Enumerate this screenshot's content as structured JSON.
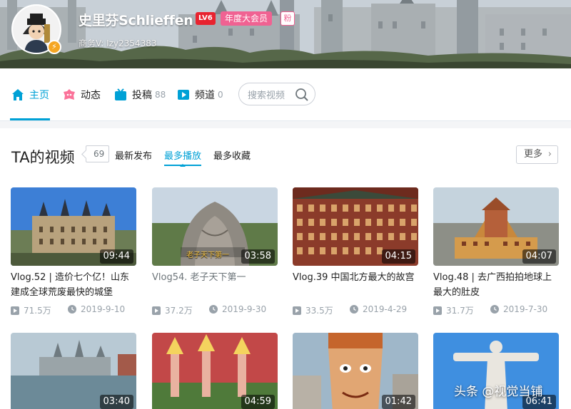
{
  "profile": {
    "username": "史里芬Schlieffen",
    "level": "LV6",
    "vip_badge": "年度大会员",
    "fan_badge": "粉",
    "business": "商务V: Izy2354383",
    "colors": {
      "level": "#e8232f",
      "vip": "#f06292",
      "accent": "#00a1d6"
    }
  },
  "nav": {
    "items": [
      {
        "label": "主页",
        "icon": "home-icon",
        "count": ""
      },
      {
        "label": "动态",
        "icon": "dynamic-icon",
        "count": ""
      },
      {
        "label": "投稿",
        "icon": "upload-icon",
        "count": "88"
      },
      {
        "label": "频道",
        "icon": "channel-icon",
        "count": "0"
      }
    ],
    "active": "主页",
    "search_placeholder": "搜索视频"
  },
  "videos_section": {
    "title": "TA的视频",
    "count": "69",
    "sort_tabs": [
      "最新发布",
      "最多播放",
      "最多收藏"
    ],
    "active_sort": "最多播放",
    "more_label": "更多",
    "more_chevron": "›"
  },
  "videos": [
    {
      "duration": "09:44",
      "title": "Vlog.52 | 造价七个亿！山东建成全球荒废最快的城堡",
      "plays": "71.5万",
      "date": "2019-9-10",
      "dim": false
    },
    {
      "duration": "03:58",
      "title": "Vlog54. 老子天下第一",
      "plays": "37.2万",
      "date": "2019-9-30",
      "dim": true
    },
    {
      "duration": "04:15",
      "title": "Vlog.39 中国北方最大的故宫",
      "plays": "33.5万",
      "date": "2019-4-29",
      "dim": false
    },
    {
      "duration": "04:07",
      "title": "Vlog.48 | 去广西拍拍地球上最大的肚皮",
      "plays": "31.7万",
      "date": "2019-7-30",
      "dim": false
    },
    {
      "duration": "03:40",
      "title": "",
      "plays": "",
      "date": "",
      "dim": false
    },
    {
      "duration": "04:59",
      "title": "",
      "plays": "",
      "date": "",
      "dim": false
    },
    {
      "duration": "01:42",
      "title": "",
      "plays": "",
      "date": "",
      "dim": false
    },
    {
      "duration": "06:41",
      "title": "",
      "plays": "",
      "date": "",
      "dim": false
    }
  ],
  "thumb_caption_2": "老子天下第一",
  "watermark": "头条 @视觉当铺"
}
